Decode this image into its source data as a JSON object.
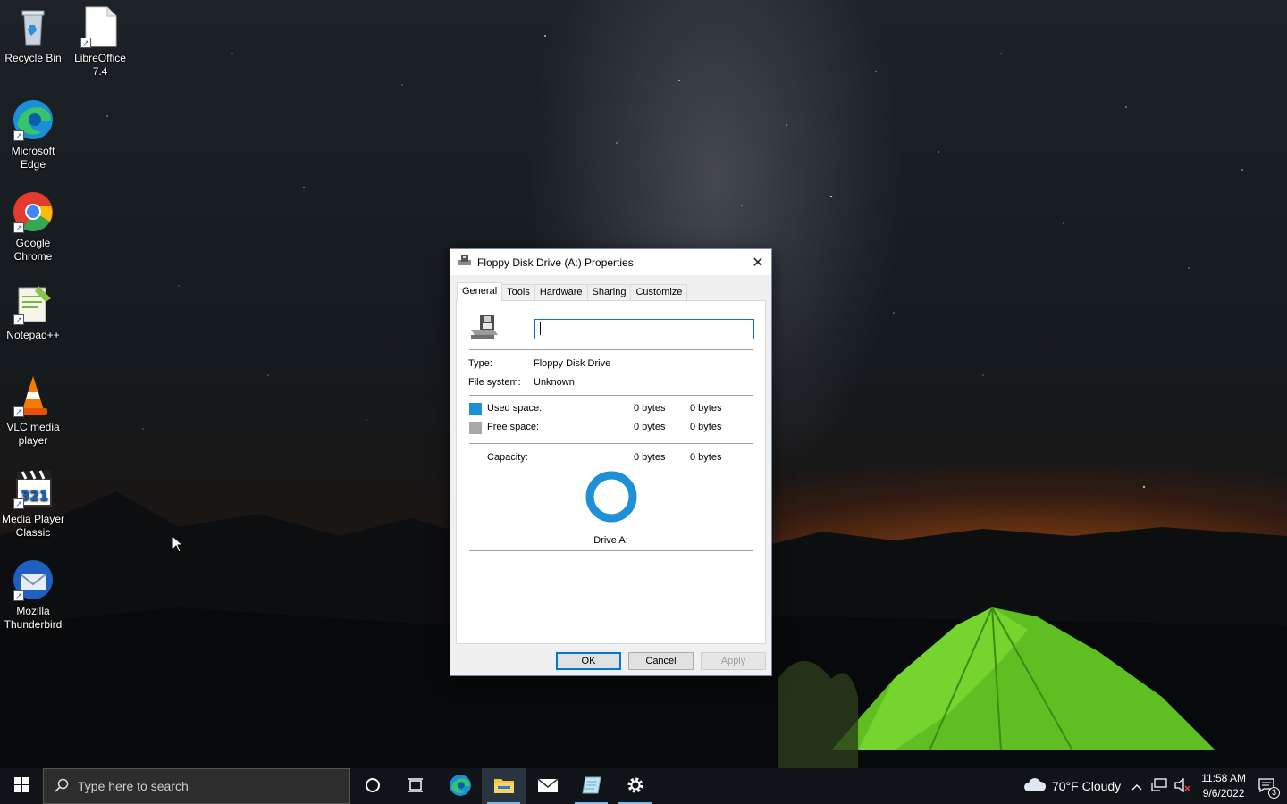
{
  "desktop": {
    "icons": [
      {
        "label": "Recycle Bin"
      },
      {
        "label": "LibreOffice 7.4"
      },
      {
        "label": "Microsoft Edge"
      },
      {
        "label": "Google Chrome"
      },
      {
        "label": "Notepad++"
      },
      {
        "label": "VLC media player"
      },
      {
        "label": "Media Player Classic"
      },
      {
        "label": "Mozilla Thunderbird"
      }
    ]
  },
  "dialog": {
    "title": "Floppy Disk Drive (A:) Properties",
    "tabs": [
      "General",
      "Tools",
      "Hardware",
      "Sharing",
      "Customize"
    ],
    "active_tab": "General",
    "name_value": "",
    "type_label": "Type:",
    "type_value": "Floppy Disk Drive",
    "fs_label": "File system:",
    "fs_value": "Unknown",
    "used_label": "Used space:",
    "used_bytes": "0 bytes",
    "used_human": "0 bytes",
    "free_label": "Free space:",
    "free_bytes": "0 bytes",
    "free_human": "0 bytes",
    "capacity_label": "Capacity:",
    "capacity_bytes": "0 bytes",
    "capacity_human": "0 bytes",
    "drive_label": "Drive A:",
    "used_color": "#1e90d6",
    "free_color": "#a8a8a8",
    "buttons": {
      "ok": "OK",
      "cancel": "Cancel",
      "apply": "Apply"
    }
  },
  "taskbar": {
    "search_placeholder": "Type here to search",
    "weather": "70°F  Cloudy",
    "time": "11:58 AM",
    "date": "9/6/2022",
    "notification_count": "3"
  }
}
